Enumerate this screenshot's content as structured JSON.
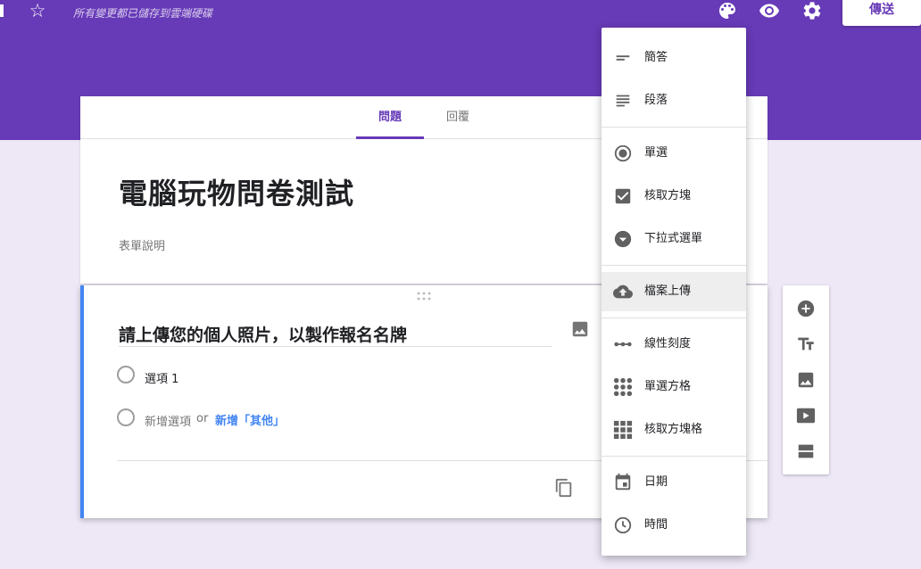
{
  "header": {
    "saved_status": "所有變更都已儲存到雲端硬碟",
    "send_label": "傳送",
    "icons": [
      "palette-icon",
      "eye-icon",
      "gear-icon"
    ]
  },
  "tabs": [
    {
      "label": "問題",
      "active": true
    },
    {
      "label": "回覆",
      "active": false
    }
  ],
  "form": {
    "title": "電腦玩物問卷測試",
    "description_placeholder": "表單說明"
  },
  "question": {
    "title": "請上傳您的個人照片，以製作報名名牌",
    "options": [
      "選項 1"
    ],
    "add_option": "新增選項",
    "or": "or",
    "add_other": "新增「其他」"
  },
  "menu": {
    "items": [
      {
        "label": "簡答",
        "icon": "short-answer-icon"
      },
      {
        "label": "段落",
        "icon": "paragraph-icon"
      },
      {
        "label": "單選",
        "icon": "radio-icon"
      },
      {
        "label": "核取方塊",
        "icon": "checkbox-icon"
      },
      {
        "label": "下拉式選單",
        "icon": "dropdown-icon"
      },
      {
        "label": "檔案上傳",
        "icon": "cloud-upload-icon"
      },
      {
        "label": "線性刻度",
        "icon": "linear-scale-icon"
      },
      {
        "label": "單選方格",
        "icon": "grid-dots-icon"
      },
      {
        "label": "核取方塊格",
        "icon": "grid-squares-icon"
      },
      {
        "label": "日期",
        "icon": "calendar-icon"
      },
      {
        "label": "時間",
        "icon": "clock-icon"
      }
    ],
    "highlighted": "檔案上傳"
  },
  "side_toolbar": [
    "add-question-icon",
    "title-text-icon",
    "add-image-icon",
    "add-video-icon",
    "add-section-icon"
  ],
  "colors": {
    "accent": "#673ab7",
    "background": "#ede7f6",
    "link": "#4285f4"
  }
}
